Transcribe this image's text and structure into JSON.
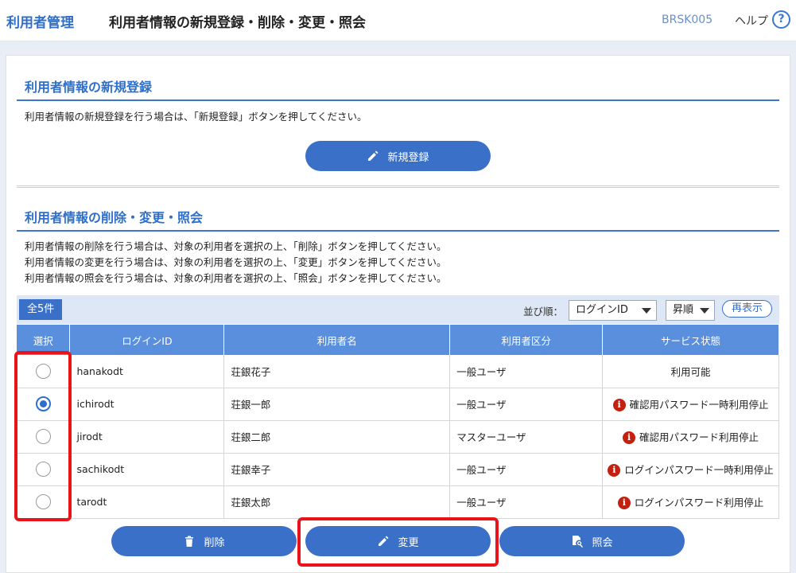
{
  "header": {
    "app_title": "利用者管理",
    "page_title": "利用者情報の新規登録・削除・変更・照会",
    "screen_id": "BRSK005",
    "help_label": "ヘルプ",
    "help_icon": "?"
  },
  "register_section": {
    "heading": "利用者情報の新規登録",
    "description": "利用者情報の新規登録を行う場合は、「新規登録」ボタンを押してください。",
    "button_label": "新規登録",
    "button_icon": "pencil-icon"
  },
  "manage_section": {
    "heading": "利用者情報の削除・変更・照会",
    "descriptions": [
      "利用者情報の削除を行う場合は、対象の利用者を選択の上、「削除」ボタンを押してください。",
      "利用者情報の変更を行う場合は、対象の利用者を選択の上、「変更」ボタンを押してください。",
      "利用者情報の照会を行う場合は、対象の利用者を選択の上、「照会」ボタンを押してください。"
    ],
    "count_badge": "全5件",
    "sort_label": "並び順：",
    "sort_field": "ログインID",
    "sort_order": "昇順",
    "redisplay_label": "再表示"
  },
  "table": {
    "headers": [
      "選択",
      "ログインID",
      "利用者名",
      "利用者区分",
      "サービス状態"
    ],
    "rows": [
      {
        "login_id": "hanakodt",
        "name": "荘銀花子",
        "category": "一般ユーザ",
        "status": "利用可能",
        "warning": false,
        "selected": false
      },
      {
        "login_id": "ichirodt",
        "name": "荘銀一郎",
        "category": "一般ユーザ",
        "status": "確認用パスワード一時利用停止",
        "warning": true,
        "selected": true
      },
      {
        "login_id": "jirodt",
        "name": "荘銀二郎",
        "category": "マスターユーザ",
        "status": "確認用パスワード利用停止",
        "warning": true,
        "selected": false
      },
      {
        "login_id": "sachikodt",
        "name": "荘銀幸子",
        "category": "一般ユーザ",
        "status": "ログインパスワード一時利用停止",
        "warning": true,
        "selected": false
      },
      {
        "login_id": "tarodt",
        "name": "荘銀太郎",
        "category": "一般ユーザ",
        "status": "ログインパスワード利用停止",
        "warning": true,
        "selected": false
      }
    ],
    "warning_icon": "i"
  },
  "actions": {
    "delete_label": "削除",
    "delete_icon": "trash-icon",
    "change_label": "変更",
    "change_icon": "pencil-icon",
    "view_label": "照会",
    "view_icon": "document-search-icon"
  },
  "colors": {
    "accent": "#2f6fc9",
    "button": "#3b70c8",
    "table_header": "#5a8fdd",
    "highlight": "#e8141a",
    "warning": "#c4200f"
  }
}
